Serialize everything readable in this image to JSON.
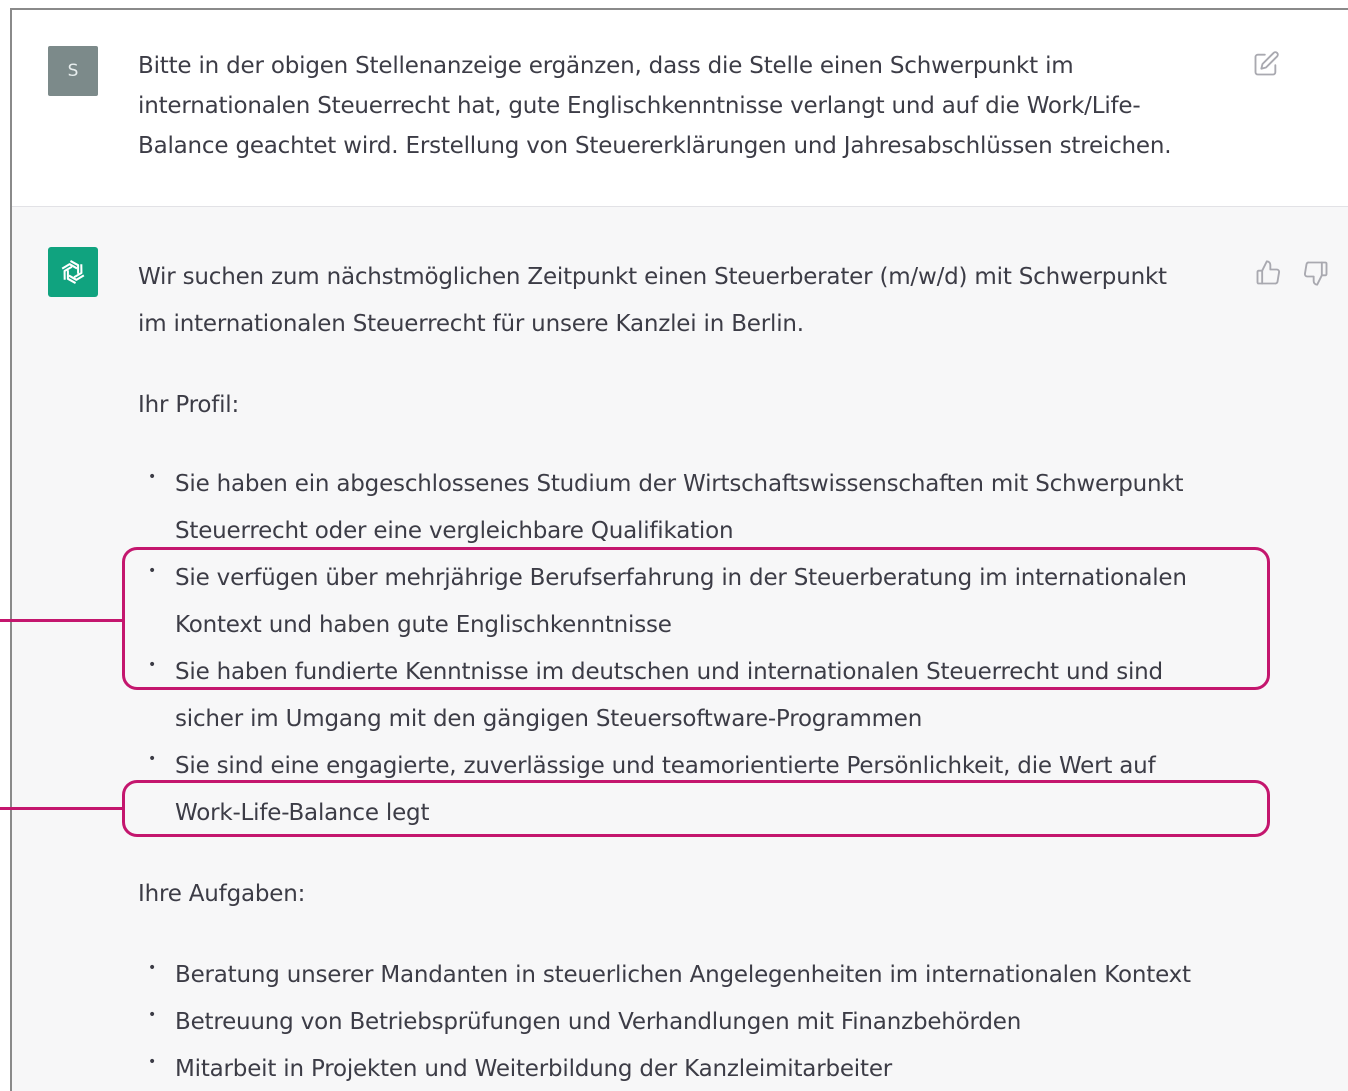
{
  "user_message": {
    "avatar_letter": "S",
    "lines": [
      "Bitte in der obigen Stellenanzeige ergänzen, dass die Stelle einen Schwerpunkt im",
      "internationalen Steuerrecht hat, gute Englischkenntnisse verlangt und auf die Work/Life-",
      "Balance geachtet wird. Erstellung von Steuererklärungen und Jahresabschlüssen streichen."
    ],
    "edit_icon": "edit-icon"
  },
  "assistant_message": {
    "avatar_icon": "openai-logo-icon",
    "intro_lines": [
      "Wir suchen zum nächstmöglichen Zeitpunkt einen Steuerberater (m/w/d) mit Schwerpunkt",
      "im internationalen Steuerrecht für unsere Kanzlei in Berlin."
    ],
    "profile_heading": "Ihr Profil:",
    "profile_items": [
      [
        "Sie haben ein abgeschlossenes Studium der Wirtschaftswissenschaften mit Schwerpunkt",
        "Steuerrecht oder eine vergleichbare Qualifikation"
      ],
      [
        "Sie verfügen über mehrjährige Berufserfahrung in der Steuerberatung im internationalen",
        "Kontext und haben gute Englischkenntnisse"
      ],
      [
        "Sie haben fundierte Kenntnisse im deutschen und internationalen Steuerrecht und sind",
        "sicher im Umgang mit den gängigen Steuersoftware-Programmen"
      ],
      [
        "Sie sind eine engagierte, zuverlässige und teamorientierte Persönlichkeit, die Wert auf",
        "Work-Life-Balance legt"
      ]
    ],
    "tasks_heading": "Ihre Aufgaben:",
    "task_items": [
      "Beratung unserer Mandanten in steuerlichen Angelegenheiten im internationalen Kontext",
      "Betreuung von Betriebsprüfungen und Verhandlungen mit Finanzbehörden",
      "Mitarbeit in Projekten und Weiterbildung der Kanzleimitarbeiter"
    ],
    "feedback_icons": [
      "thumbs-up-icon",
      "thumbs-down-icon"
    ]
  },
  "colors": {
    "highlight": "#c4166e",
    "assistant_bg": "#f7f7f8",
    "bot_avatar": "#10a37f",
    "user_avatar": "#7c8a8a"
  }
}
